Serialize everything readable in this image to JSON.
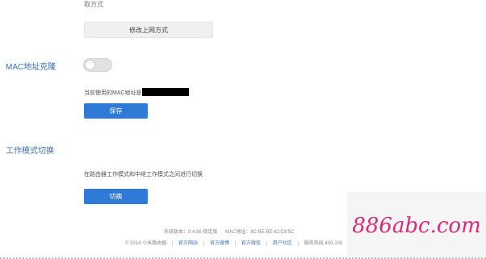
{
  "top_crop_text": "取方式",
  "change_btn_label": "修改上网方式",
  "mac_section": {
    "title": "MAC地址克隆",
    "current_label": "当前使用的MAC地址是",
    "save_label": "保存"
  },
  "mode_section": {
    "title": "工作模式切换",
    "desc": "在路由器工作模式和中继工作模式之间进行切换",
    "switch_label": "切换"
  },
  "footer": {
    "version": "系统版本：0.4.86 稳定版",
    "mac": "MAC地址：8C:BE:BE:42:C8:5C",
    "copyright": "© 2014 小米路由器",
    "links": [
      "官方网站",
      "官方微博",
      "官方微信",
      "用户社区"
    ],
    "hotline": "服务热线 400-100"
  },
  "watermark": "886abc.com",
  "colors": {
    "accent": "#2f7ad6",
    "section_title": "#3a6fb5",
    "watermark": "#e0287a"
  }
}
